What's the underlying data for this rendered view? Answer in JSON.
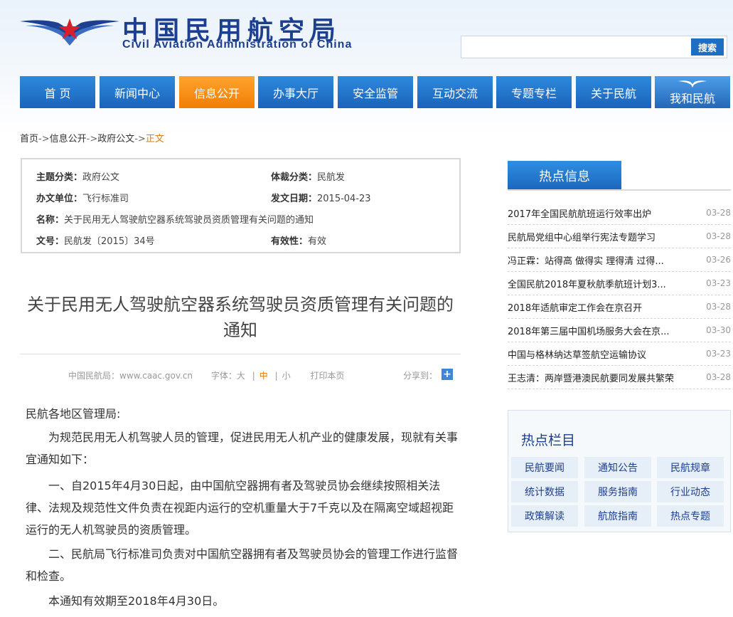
{
  "header": {
    "site_name_cn": "中国民用航空局",
    "site_name_en": "Civil Aviation Administration of China",
    "search_placeholder": "",
    "search_button": "搜索"
  },
  "nav": {
    "items": [
      {
        "label": "首 页"
      },
      {
        "label": "新闻中心"
      },
      {
        "label": "信息公开",
        "active": true
      },
      {
        "label": "办事大厅"
      },
      {
        "label": "安全监管"
      },
      {
        "label": "互动交流"
      },
      {
        "label": "专题专栏"
      },
      {
        "label": "关于民航"
      },
      {
        "label": "我和民航"
      }
    ]
  },
  "breadcrumb": {
    "home": "首页",
    "level1": "信息公开",
    "level2": "政府公文",
    "current": "正文",
    "separator": "->"
  },
  "meta": {
    "subject_key": "主题分类：",
    "subject_val": "政府公文",
    "genre_key": "体裁分类：",
    "genre_val": "民航发",
    "org_key": "办文单位：",
    "org_val": "飞行标准司",
    "date_key": "发文日期：",
    "date_val": "2015-04-23",
    "name_key": "名称：",
    "name_val": "关于民用无人驾驶航空器系统驾驶员资质管理有关问题的通知",
    "docno_key": "文号：",
    "docno_val": "民航发〔2015〕34号",
    "valid_key": "有效性：",
    "valid_val": "有效"
  },
  "article": {
    "title_line1": "关于民用无人驾驶航空器系统驾驶员资质管理有关问题的",
    "title_line2": "通知",
    "source": "中国民航局：www.caac.gov.cn",
    "font_label": "字体：",
    "font_large": "大",
    "font_mid": "中",
    "font_small": "小",
    "font_sep": "|",
    "print": "打印本页",
    "share": "分享到：",
    "share_icon": "+",
    "salutation": "民航各地区管理局:",
    "p1": "为规范民用无人机驾驶人员的管理，促进民用无人机产业的健康发展，现就有关事宜通知如下：",
    "p2": "一、自2015年4月30日起，由中国航空器拥有者及驾驶员协会继续按照相关法律、法规及规范性文件负责在视距内运行的空机重量大于7千克以及在隔离空域超视距运行的无人机驾驶员的资质管理。",
    "p3": "二、民航局飞行标准司负责对中国航空器拥有者及驾驶员协会的管理工作进行监督和检查。",
    "p4": "本通知有效期至2018年4月30日。"
  },
  "hot_info": {
    "title": "热点信息",
    "items": [
      {
        "title": "2017年全国民航航班运行效率出炉",
        "date": "03-28"
      },
      {
        "title": "民航局党组中心组举行宪法专题学习",
        "date": "03-28"
      },
      {
        "title": "冯正霖：站得高 做得实 理得清 过得...",
        "date": "03-26"
      },
      {
        "title": "全国民航2018年夏秋航季航班计划3...",
        "date": "03-23"
      },
      {
        "title": "2018年适航审定工作会在京召开",
        "date": "03-28"
      },
      {
        "title": "2018年第三届中国机场服务大会在京...",
        "date": "03-30"
      },
      {
        "title": "中国与格林纳达草签航空运输协议",
        "date": "03-23"
      },
      {
        "title": "王志清：两岸暨港澳民航要同发展共繁荣",
        "date": "03-28"
      }
    ]
  },
  "hot_columns": {
    "title": "热点栏目",
    "items": [
      "民航要闻",
      "通知公告",
      "民航规章",
      "统计数据",
      "服务指南",
      "行业动态",
      "政策解读",
      "航旅指南",
      "热点专题"
    ]
  },
  "colors": {
    "nav_blue": "#1b63ba",
    "nav_active": "#f07e05",
    "brand_navy": "#1d3f8f",
    "accent_orange": "#e07a10"
  }
}
